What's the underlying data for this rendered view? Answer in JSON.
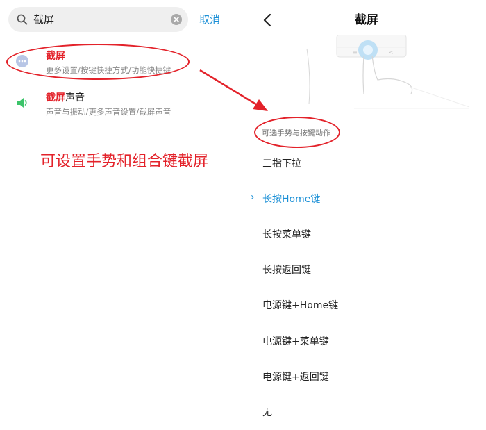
{
  "search": {
    "query": "截屏",
    "cancel_label": "取消"
  },
  "results": [
    {
      "title_highlight": "截屏",
      "title_rest": "",
      "subtitle": "更多设置/按键快捷方式/功能快捷键",
      "icon": "more-dots-icon"
    },
    {
      "title_highlight": "截屏",
      "title_rest": "声音",
      "subtitle": "声音与振动/更多声音设置/截屏声音",
      "icon": "speaker-icon"
    }
  ],
  "annotation": "可设置手势和组合键截屏",
  "detail": {
    "title": "截屏",
    "section_header": "可选手势与按键动作",
    "options": [
      {
        "label": "三指下拉",
        "selected": false
      },
      {
        "label": "长按Home键",
        "selected": true
      },
      {
        "label": "长按菜单键",
        "selected": false
      },
      {
        "label": "长按返回键",
        "selected": false
      },
      {
        "label": "电源键+Home键",
        "selected": false
      },
      {
        "label": "电源键+菜单键",
        "selected": false
      },
      {
        "label": "电源键+返回键",
        "selected": false
      },
      {
        "label": "无",
        "selected": false
      }
    ],
    "selected_marker": "›"
  },
  "colors": {
    "accent": "#1a8fd6",
    "highlight": "#e3222a",
    "annotation": "#e3222a"
  }
}
